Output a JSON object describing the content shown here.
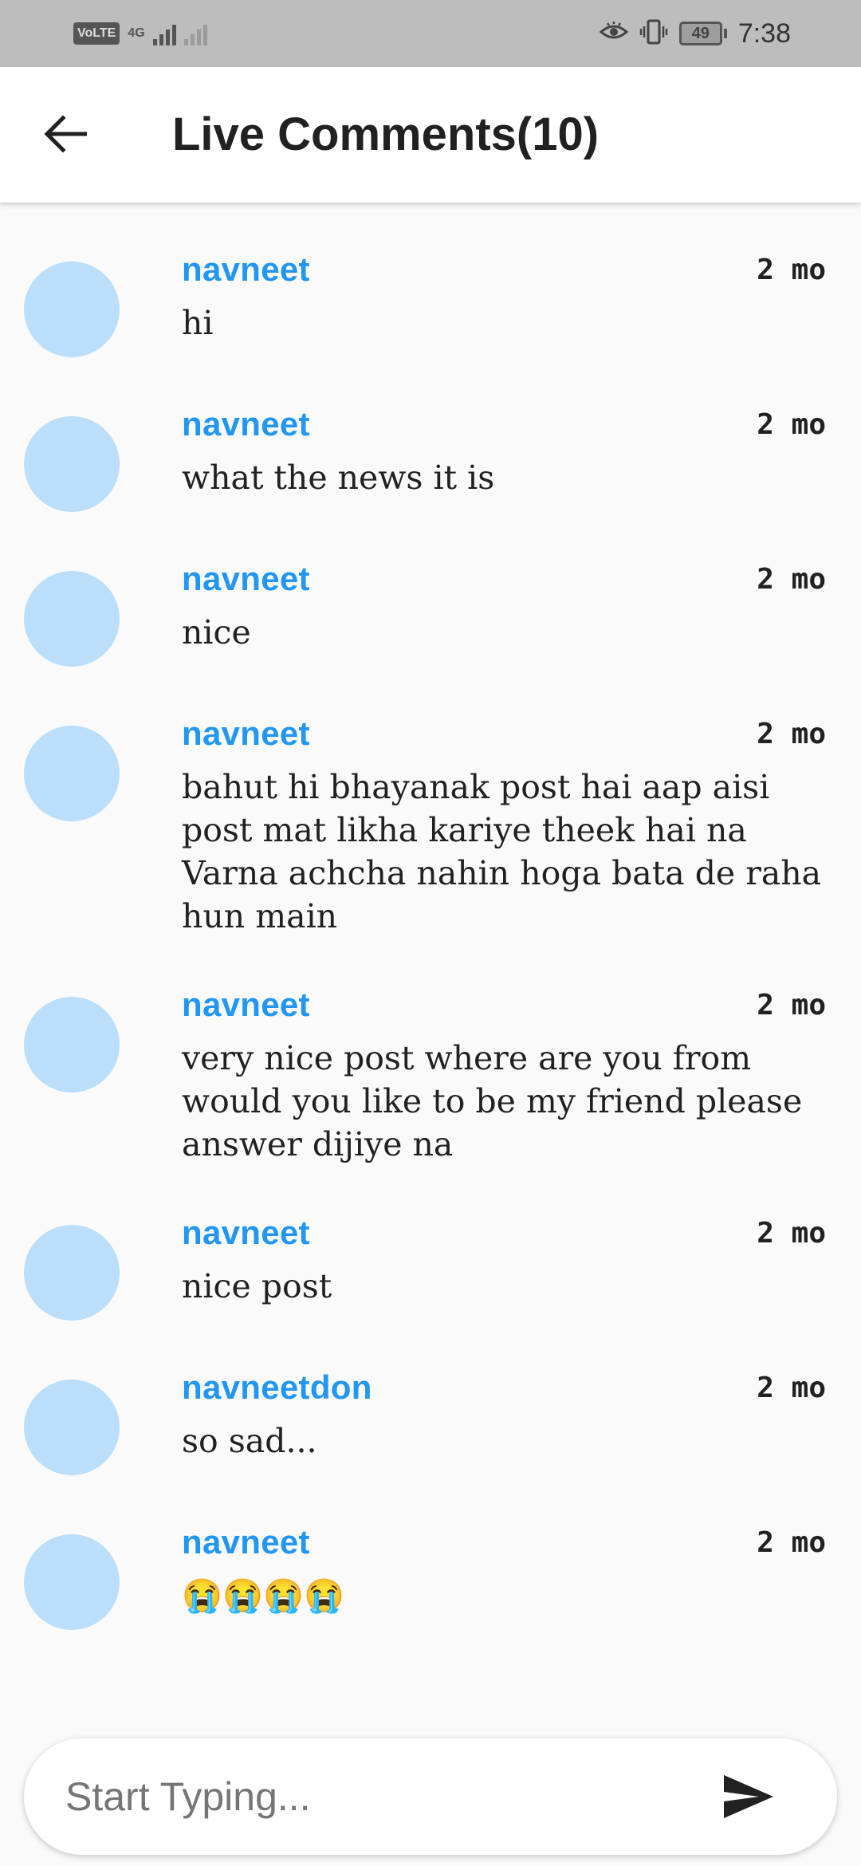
{
  "status_bar": {
    "volte": "VoLTE",
    "network": "4G",
    "battery": "49",
    "time": "7:38"
  },
  "app_bar": {
    "title": "Live Comments(10)",
    "back_icon": "arrow-left-icon"
  },
  "comments": [
    {
      "user": "navneet",
      "ago": "2 mo",
      "text": "hi"
    },
    {
      "user": "navneet",
      "ago": "2 mo",
      "text": "what the news it is"
    },
    {
      "user": "navneet",
      "ago": "2 mo",
      "text": "nice"
    },
    {
      "user": "navneet",
      "ago": "2 mo",
      "text": "bahut hi bhayanak post hai aap aisi post mat likha kariye theek hai na Varna achcha nahin hoga bata de raha hun main"
    },
    {
      "user": "navneet",
      "ago": "2 mo",
      "text": "very nice post where are you from would you like to be my friend please answer dijiye na"
    },
    {
      "user": "navneet",
      "ago": "2 mo",
      "text": "nice post"
    },
    {
      "user": "navneetdon",
      "ago": "2 mo",
      "text": "so sad..."
    },
    {
      "user": "navneet",
      "ago": "2 mo",
      "text": "😭😭😭😭"
    }
  ],
  "input": {
    "placeholder": "Start Typing...",
    "value": "",
    "send_icon": "send-icon"
  },
  "colors": {
    "username": "#2196f3",
    "avatar": "#bbdefb",
    "status_bar": "#bdbdbd"
  }
}
